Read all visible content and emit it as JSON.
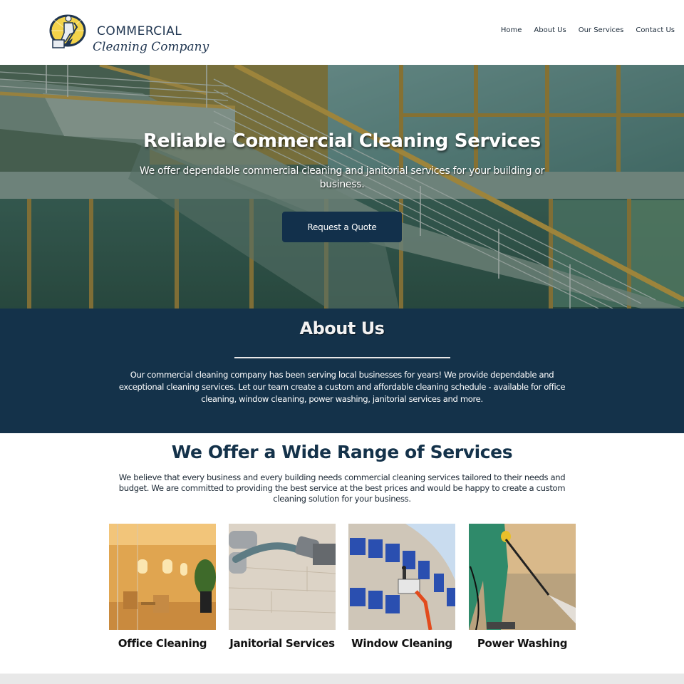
{
  "header": {
    "logo": {
      "line1": "COMMERCIAL",
      "line2": "Cleaning Company",
      "emblem": "janitor-mopping-emblem-icon"
    },
    "nav": [
      {
        "label": "Home"
      },
      {
        "label": "About Us"
      },
      {
        "label": "Our Services"
      },
      {
        "label": "Contact Us"
      }
    ]
  },
  "hero": {
    "title": "Reliable Commercial Cleaning Services",
    "subtitle": "We offer dependable commercial cleaning and janitorial services for your building or business.",
    "cta_label": "Request a Quote",
    "background": "office-staircase-glass-facade-photo"
  },
  "about": {
    "title": "About Us",
    "text": "Our commercial cleaning company has been serving local businesses for years! We provide dependable and exceptional cleaning services. Let our team create a custom and affordable cleaning schedule - available for office cleaning, window cleaning, power washing, janitorial services and more."
  },
  "services": {
    "title": "We Offer a Wide Range of Services",
    "text": "We believe that every business and every building needs commercial cleaning services tailored to their needs and budget. We are committed to providing the best service at the best prices and would be happy to create a custom cleaning solution for your business.",
    "items": [
      {
        "label": "Office Cleaning",
        "image": "office-lounge-photo"
      },
      {
        "label": "Janitorial Services",
        "image": "vacuum-floor-photo"
      },
      {
        "label": "Window Cleaning",
        "image": "window-washer-lift-photo"
      },
      {
        "label": "Power Washing",
        "image": "pressure-washer-photo"
      }
    ]
  },
  "colors": {
    "brand_navy": "#14324a",
    "button_navy": "#12304b",
    "text_dark": "#1d2a36",
    "footer_gray": "#e8e8e8"
  }
}
